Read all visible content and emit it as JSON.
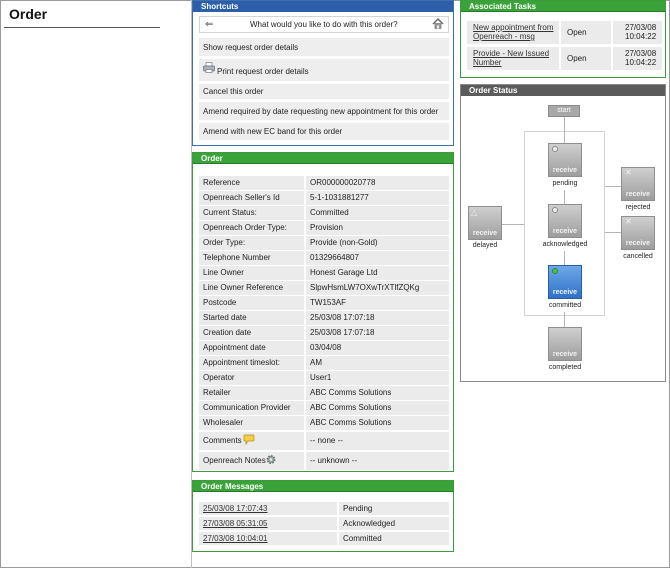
{
  "page": {
    "title": "Order"
  },
  "shortcuts": {
    "header": "Shortcuts",
    "question": "What would you like to do with this order?",
    "back_icon": "back-arrow-icon",
    "home_icon": "home-icon",
    "items": [
      "Show request order details",
      "Print request order details",
      "Cancel this order",
      "Amend required by date requesting new appointment for this order",
      "Amend with new EC band for this order"
    ]
  },
  "order": {
    "header": "Order",
    "rows": [
      {
        "label": "Reference",
        "value": "OR000000020778"
      },
      {
        "label": "Openreach Seller's Id",
        "value": "5-1-1031881277"
      },
      {
        "label": "Current Status:",
        "value": "Committed"
      },
      {
        "label": "Openreach Order Type:",
        "value": "Provision"
      },
      {
        "label": "Order Type:",
        "value": "Provide (non-Gold)"
      },
      {
        "label": "Telephone Number",
        "value": "01329664807"
      },
      {
        "label": "Line Owner",
        "value": "Honest Garage Ltd"
      },
      {
        "label": "Line Owner Reference",
        "value": "SlpwHsmLW7OXwTrXTlfZQKg"
      },
      {
        "label": "Postcode",
        "value": "TW153AF"
      },
      {
        "label": "Started date",
        "value": "25/03/08 17:07:18"
      },
      {
        "label": "Creation date",
        "value": "25/03/08 17:07:18"
      },
      {
        "label": "Appointment date",
        "value": "03/04/08"
      },
      {
        "label": "Appointment timeslot:",
        "value": "AM"
      },
      {
        "label": "Operator",
        "value": "User1"
      },
      {
        "label": "Retailer",
        "value": "ABC Comms Solutions"
      },
      {
        "label": "Communication Provider",
        "value": "ABC Comms Solutions"
      },
      {
        "label": "Wholesaler",
        "value": "ABC Comms Solutions"
      }
    ],
    "comments": {
      "label": "Comments",
      "value": "-- none --"
    },
    "notes": {
      "label": "Openreach Notes",
      "value": "-- unknown --"
    }
  },
  "messages": {
    "header": "Order Messages",
    "rows": [
      {
        "date": "25/03/08 17:07:43",
        "status": "Pending"
      },
      {
        "date": "27/03/08 05:31:05",
        "status": "Acknowledged"
      },
      {
        "date": "27/03/08 10:04:01",
        "status": "Committed"
      }
    ]
  },
  "tasks": {
    "header": "Associated Tasks",
    "rows": [
      {
        "line1": "New appointment from",
        "line2": "Openreach - msg",
        "status": "Open",
        "date": "27/03/08",
        "time": "10:04:22"
      },
      {
        "line1": "Provide - New Issued",
        "line2": "Number",
        "status": "Open",
        "date": "27/03/08",
        "time": "10:04:22"
      }
    ]
  },
  "status": {
    "header": "Order Status",
    "start_label": "start",
    "box_label": "receive",
    "current_state": "committed",
    "states": {
      "pending": "pending",
      "acknowledged": "acknowledged",
      "committed": "committed",
      "completed": "completed",
      "delayed": "delayed",
      "rejected": "rejected",
      "cancelled": "cancelled"
    }
  },
  "colors": {
    "blue_header": "#2d5fa8",
    "green_header": "#39a339",
    "gray_header": "#5b5b5b",
    "active_state": "#2f71c9"
  }
}
